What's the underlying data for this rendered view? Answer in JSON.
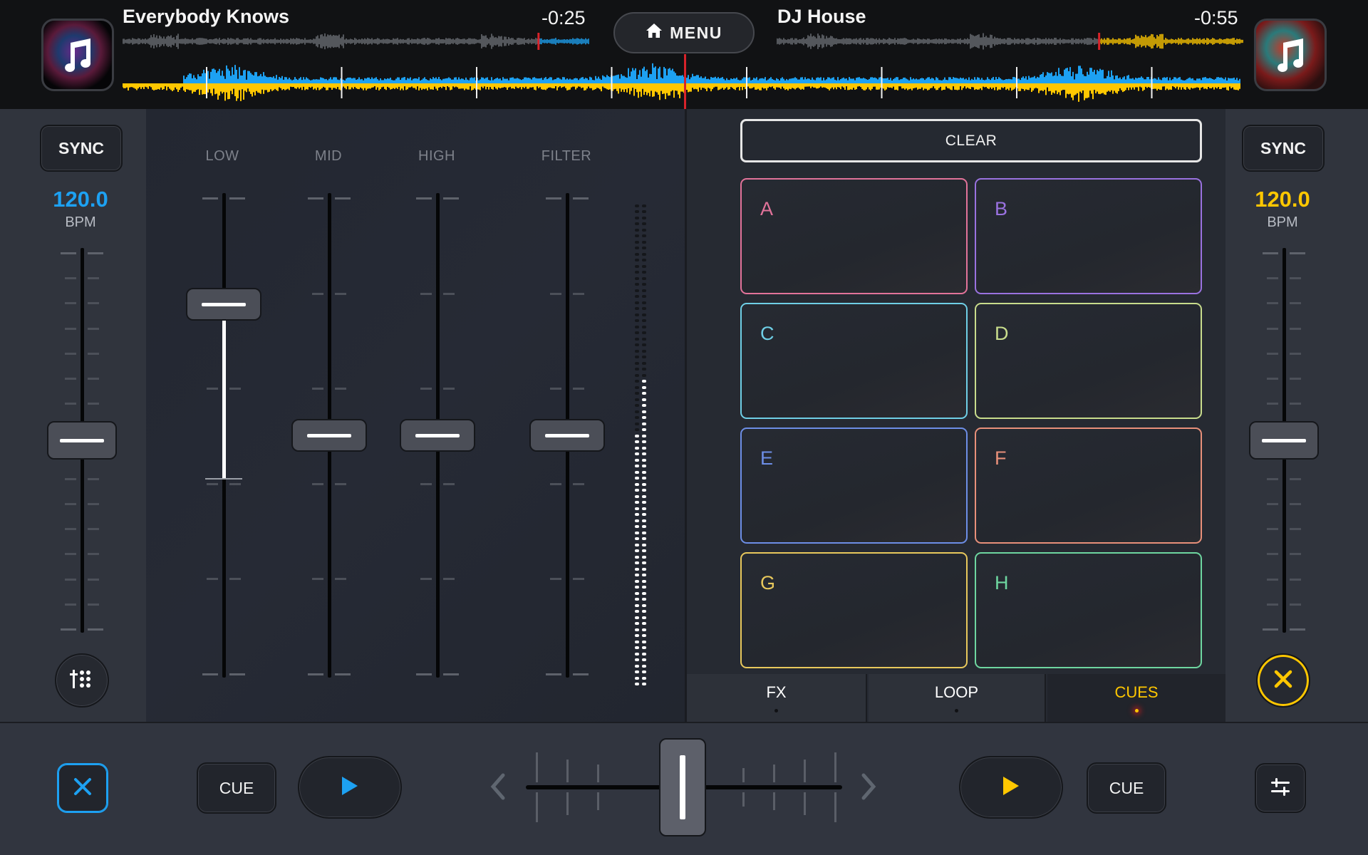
{
  "header": {
    "menu_label": "MENU",
    "deck_left": {
      "title": "Everybody Knows",
      "time_remaining": "-0:25",
      "art_icon": "music-note-icon",
      "accent": "#1da1f2",
      "played_fraction": 0.89
    },
    "deck_right": {
      "title": "DJ House",
      "time_remaining": "-0:55",
      "art_icon": "music-note-icon",
      "accent": "#ffc700",
      "played_fraction": 0.69
    }
  },
  "left_deck": {
    "sync_label": "SYNC",
    "bpm": "120.0",
    "bpm_unit": "BPM",
    "bpm_color": "#1da1f2",
    "pitch_position": 0.5,
    "tool_button_icon": "mixer-grid-icon"
  },
  "right_deck": {
    "sync_label": "SYNC",
    "bpm": "120.0",
    "bpm_unit": "BPM",
    "bpm_color": "#ffc700",
    "pitch_position": 0.5,
    "close_button_icon": "close-icon"
  },
  "mixer": {
    "eq": [
      {
        "label": "LOW",
        "value": 0.77
      },
      {
        "label": "MID",
        "value": 0.5
      },
      {
        "label": "HIGH",
        "value": 0.5
      },
      {
        "label": "FILTER",
        "value": 0.5
      }
    ],
    "level_meter": {
      "left_fraction": 0.52,
      "right_fraction": 0.63
    }
  },
  "pads": {
    "clear_label": "CLEAR",
    "items": [
      {
        "label": "A",
        "color": "#e2739a"
      },
      {
        "label": "B",
        "color": "#9a72e0"
      },
      {
        "label": "C",
        "color": "#6fcfe6"
      },
      {
        "label": "D",
        "color": "#c8dc8c"
      },
      {
        "label": "E",
        "color": "#6d8ee6"
      },
      {
        "label": "F",
        "color": "#e8907a"
      },
      {
        "label": "G",
        "color": "#e8c85c"
      },
      {
        "label": "H",
        "color": "#6ed6a0"
      }
    ]
  },
  "tabs": [
    {
      "label": "FX",
      "active": false
    },
    {
      "label": "LOOP",
      "active": false
    },
    {
      "label": "CUES",
      "active": true
    }
  ],
  "transport": {
    "left_cue_label": "CUE",
    "right_cue_label": "CUE",
    "left_play_color": "#1da1f2",
    "right_play_color": "#ffc700",
    "crossfader_position": 0.45,
    "left_corner_icon": "close-icon",
    "right_corner_icon": "sliders-icon"
  }
}
